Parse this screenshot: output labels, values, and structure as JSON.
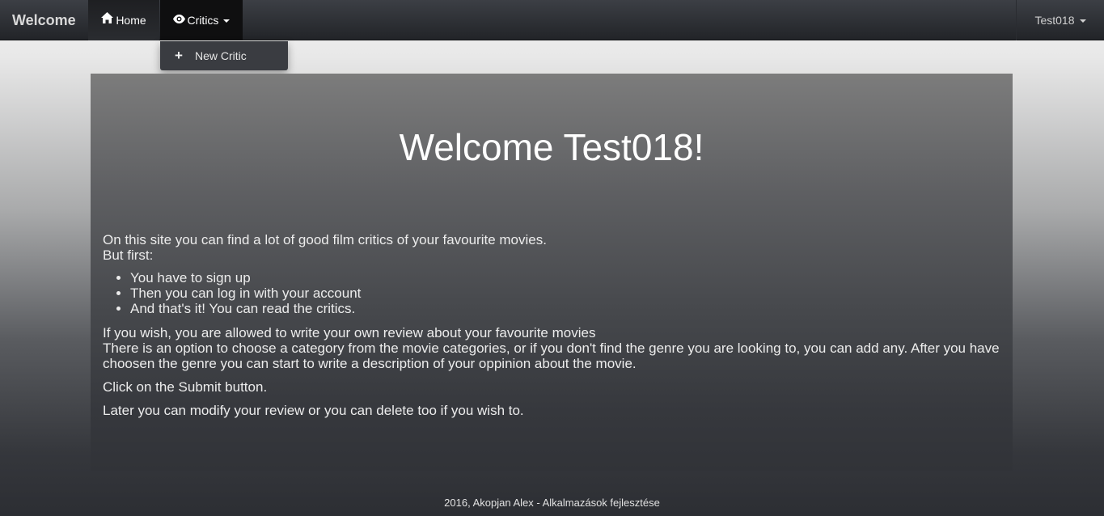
{
  "navbar": {
    "brand": "Welcome",
    "home_label": "Home",
    "home_icon": "home-icon",
    "critics_label": "Critics",
    "critics_icon": "eye-icon",
    "user_label": "Test018"
  },
  "dropdown": {
    "items": [
      {
        "label": "New Critic",
        "icon": "plus-icon"
      }
    ]
  },
  "jumbotron": {
    "title": "Welcome Test018!",
    "intro_1": "On this site you can find a lot of good film critics of your favourite movies.",
    "intro_2": "But first:",
    "steps": [
      "You have to sign up",
      "Then you can log in with your account",
      "And that's it! You can read the critics."
    ],
    "para_1": "If you wish, you are allowed to write your own review about your favourite movies",
    "para_2": "There is an option to choose a category from the movie categories, or if you don't find the genre you are looking to, you can add any. After you have choosen the genre you can start to write a description of your oppinion about the movie.",
    "para_3": "Click on the Submit button.",
    "para_4": "Later you can modify your review or you can delete too if you wish to."
  },
  "footer": {
    "text": "2016, Akopjan Alex - Alkalmazások fejlesztése"
  }
}
